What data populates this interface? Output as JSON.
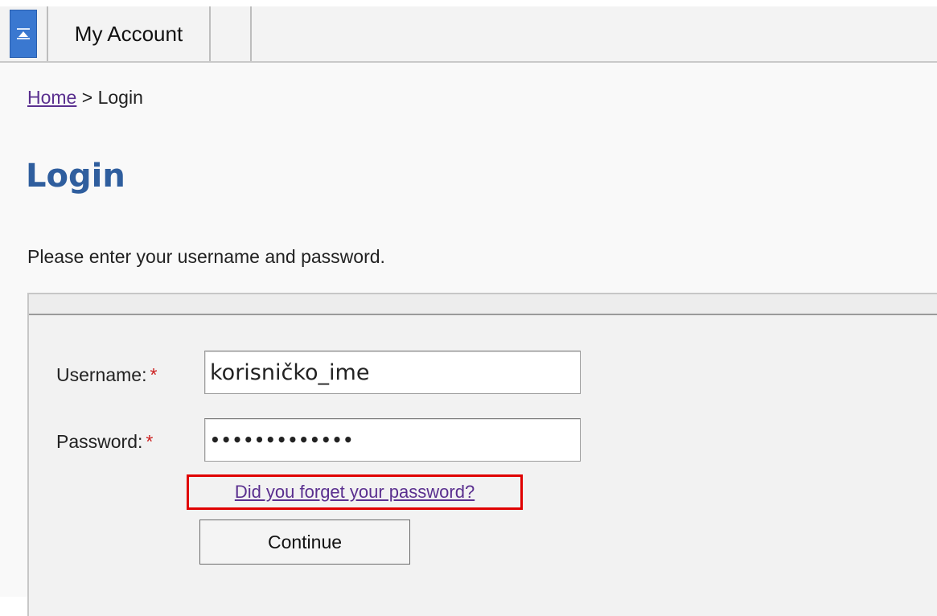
{
  "tabs": {
    "account_label": "My Account"
  },
  "breadcrumb": {
    "home_label": "Home",
    "separator": ">",
    "current_label": "Login"
  },
  "page": {
    "title": "Login",
    "instructions": "Please enter your username and password."
  },
  "form": {
    "username_label": "Username:",
    "username_value": "korisničko_ime",
    "password_label": "Password:",
    "password_value": "•••••••••••••",
    "required_marker": "*",
    "forgot_link": "Did you forget your password?",
    "continue_label": "Continue"
  },
  "colors": {
    "title": "#2f5e9e",
    "link": "#5a2f8f",
    "required": "#cc2020",
    "highlight": "#e00000",
    "tab_icon": "#3a78d0"
  },
  "icons": {
    "tab_icon": "window-icon"
  }
}
